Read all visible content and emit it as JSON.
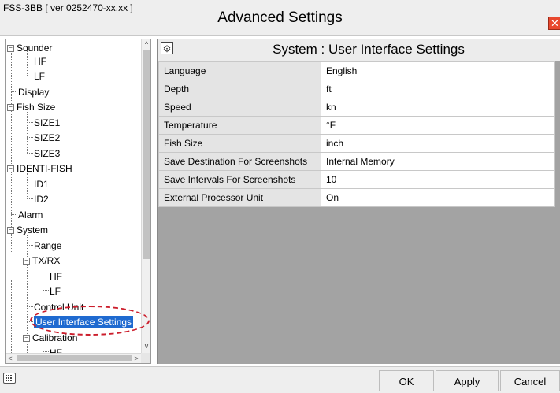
{
  "window": {
    "version_label": "FSS-3BB [ ver 0252470-xx.xx ]",
    "title": "Advanced Settings",
    "close_glyph": "✕"
  },
  "tree": {
    "items": [
      {
        "label": "Sounder",
        "expander": "−",
        "has_expander": true
      },
      {
        "label": "HF"
      },
      {
        "label": "LF"
      },
      {
        "label": "Display"
      },
      {
        "label": "Fish Size",
        "expander": "−",
        "has_expander": true
      },
      {
        "label": "SIZE1"
      },
      {
        "label": "SIZE2"
      },
      {
        "label": "SIZE3"
      },
      {
        "label": "IDENTI-FISH",
        "expander": "−",
        "has_expander": true
      },
      {
        "label": "ID1"
      },
      {
        "label": "ID2"
      },
      {
        "label": "Alarm"
      },
      {
        "label": "System",
        "expander": "−",
        "has_expander": true
      },
      {
        "label": "Range"
      },
      {
        "label": "TX/RX",
        "expander": "−",
        "has_expander": true
      },
      {
        "label": "HF"
      },
      {
        "label": "LF"
      },
      {
        "label": "Control Unit"
      },
      {
        "label": "User Interface Settings",
        "selected": true
      },
      {
        "label": "Calibration",
        "expander": "−",
        "has_expander": true
      },
      {
        "label": "HF"
      }
    ],
    "scroll_up": "^",
    "scroll_down": "v",
    "scroll_left": "<",
    "scroll_right": ">"
  },
  "panel": {
    "icon": "settings-sliders-icon",
    "title": "System : User Interface Settings",
    "rows": [
      {
        "key": "Language",
        "value": "English"
      },
      {
        "key": "Depth",
        "value": "ft"
      },
      {
        "key": "Speed",
        "value": "kn"
      },
      {
        "key": "Temperature",
        "value": "°F"
      },
      {
        "key": "Fish Size",
        "value": "inch"
      },
      {
        "key": "Save Destination For Screenshots",
        "value": "Internal Memory"
      },
      {
        "key": "Save Intervals For Screenshots",
        "value": "10"
      },
      {
        "key": "External Processor Unit",
        "value": "On"
      }
    ]
  },
  "buttons": {
    "ok": "OK",
    "apply": "Apply",
    "cancel": "Cancel"
  },
  "colors": {
    "selection": "#1f6ad0",
    "highlight_ellipse": "#cc1e2c",
    "close_button": "#e8482e",
    "panel_background": "#a3a3a3"
  }
}
